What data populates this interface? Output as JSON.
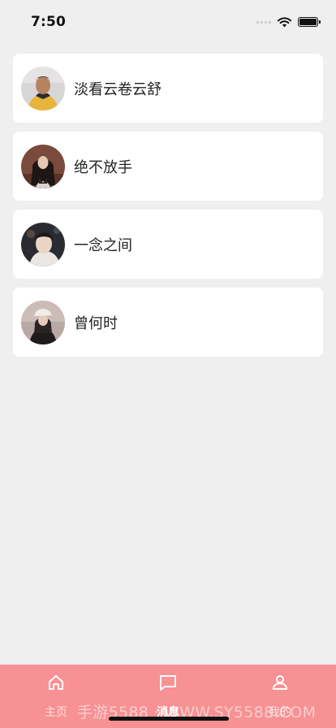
{
  "status_bar": {
    "time": "7:50"
  },
  "conversations": [
    {
      "name": "淡看云卷云舒",
      "avatar": "avatar-photo-yellow-shirt"
    },
    {
      "name": "绝不放手",
      "avatar": "avatar-photo-long-hair"
    },
    {
      "name": "一念之间",
      "avatar": "avatar-photo-night"
    },
    {
      "name": "曾何时",
      "avatar": "avatar-photo-cap"
    }
  ],
  "tab_bar": {
    "tabs": [
      {
        "label": "主页",
        "icon": "home-icon",
        "active": false
      },
      {
        "label": "消息",
        "icon": "message-icon",
        "active": true
      },
      {
        "label": "我的",
        "icon": "user-icon",
        "active": false
      }
    ],
    "background": "#f79193"
  },
  "watermark": "手游5588 · WWW.SY5588.COM"
}
